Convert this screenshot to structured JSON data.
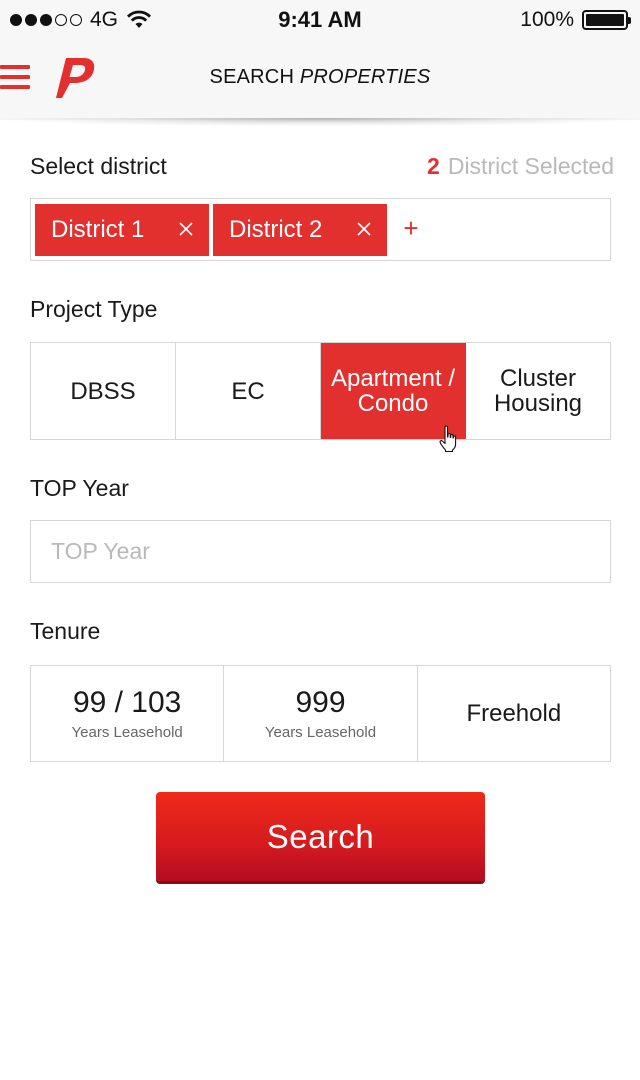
{
  "status_bar": {
    "carrier": "4G",
    "time": "9:41 AM",
    "battery": "100%"
  },
  "nav": {
    "title_regular": "SEARCH",
    "title_italic": "PROPERTIES",
    "brand_color": "#e2302f"
  },
  "district": {
    "label": "Select district",
    "count": "2",
    "count_text": "District Selected",
    "chips": [
      "District 1",
      "District 2"
    ],
    "add_symbol": "+"
  },
  "project_type": {
    "label": "Project Type",
    "options": [
      "DBSS",
      "EC",
      "Apartment / Condo",
      "Cluster Housing"
    ],
    "selected": "Apartment / Condo"
  },
  "top_year": {
    "label": "TOP Year",
    "placeholder": "TOP Year",
    "value": ""
  },
  "tenure": {
    "label": "Tenure",
    "options": [
      {
        "value": "99 / 103",
        "sub": "Years Leasehold"
      },
      {
        "value": "999",
        "sub": "Years Leasehold"
      },
      {
        "value": "Freehold",
        "sub": ""
      }
    ]
  },
  "search_button": {
    "label": "Search"
  }
}
